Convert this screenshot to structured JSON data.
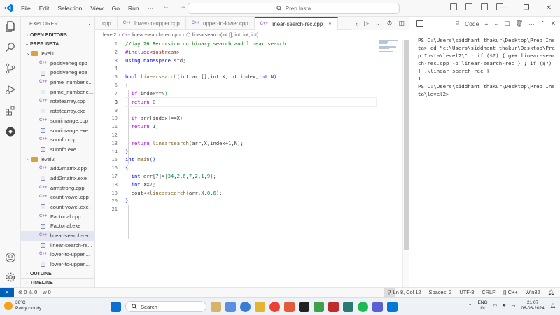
{
  "titlebar": {
    "menu": [
      "File",
      "Edit",
      "Selection",
      "View",
      "Go",
      "Run"
    ],
    "more": "···",
    "search_placeholder": "Prep Insta",
    "nav_back": "←",
    "nav_forward": "→",
    "window_controls": [
      "—",
      "❐",
      "✕"
    ]
  },
  "sidebar": {
    "title": "EXPLORER",
    "more": "···",
    "open_editors": "OPEN EDITORS",
    "project": "PREP INSTA",
    "level1_folder": "level1",
    "level1_files": [
      {
        "name": "positiveneg.cpp",
        "type": "cpp"
      },
      {
        "name": "positiveneg.exe",
        "type": "exe"
      },
      {
        "name": "prime_number.c...",
        "type": "cpp"
      },
      {
        "name": "prime_number.e...",
        "type": "exe"
      },
      {
        "name": "rotatearray.cpp",
        "type": "cpp"
      },
      {
        "name": "rotatearray.exe",
        "type": "exe"
      },
      {
        "name": "suminrange.cpp",
        "type": "cpp"
      },
      {
        "name": "suminrange.exe",
        "type": "exe"
      },
      {
        "name": "sunofn.cpp",
        "type": "cpp"
      },
      {
        "name": "sunofn.exe",
        "type": "exe"
      }
    ],
    "level2_folder": "level2",
    "level2_files": [
      {
        "name": "add2matrix.cpp",
        "type": "cpp"
      },
      {
        "name": "add2matrix.exe",
        "type": "exe"
      },
      {
        "name": "armstrong.cpp",
        "type": "cpp"
      },
      {
        "name": "count-vowel.cpp",
        "type": "cpp"
      },
      {
        "name": "count-vowel.exe",
        "type": "exe"
      },
      {
        "name": "Factorial.cpp",
        "type": "cpp"
      },
      {
        "name": "Factorial.exe",
        "type": "exe"
      },
      {
        "name": "linear-search-rec...",
        "type": "cpp",
        "selected": true
      },
      {
        "name": "linear-search-re...",
        "type": "exe"
      },
      {
        "name": "lower-to-upper....",
        "type": "cpp"
      },
      {
        "name": "lower-to-upper....",
        "type": "exe"
      }
    ],
    "outline": "OUTLINE",
    "timeline": "TIMELINE"
  },
  "tabs": [
    {
      "label": ".cpp",
      "icon": "",
      "active": false
    },
    {
      "label": "lower-to-upper.cpp",
      "icon": "C++",
      "active": false
    },
    {
      "label": "upper-to-lower.cpp",
      "icon": "C++",
      "active": false
    },
    {
      "label": "linear-search-rec.cpp",
      "icon": "C++",
      "active": true
    }
  ],
  "tab_close": "×",
  "breadcrumb": {
    "folder": "level2",
    "file_icon": "C++",
    "file": "linear-search-rec.cpp",
    "symbol": "linearsearch(int [], int, int, int)"
  },
  "editor": {
    "current_line": 8,
    "line_numbers": [
      "1",
      "2",
      "3",
      "4",
      "5",
      "6",
      "7",
      "8",
      "9",
      "10",
      "11",
      "12",
      "13",
      "14",
      "15",
      "16",
      "17",
      "18",
      "19",
      "20",
      "21"
    ]
  },
  "terminal": {
    "label": "Code",
    "output": "PS C:\\Users\\siddhant thakur\\Desktop\\Prep Insta> cd \"c:\\Users\\siddhant thakur\\Desktop\\Prep Insta\\level2\\\" ; if ($?) { g++ linear-search-rec.cpp -o linear-search-rec } ; if ($?) { .\\linear-search-rec }\n1\nPS C:\\Users\\siddhant thakur\\Desktop\\Prep Insta\\level2>"
  },
  "statusbar": {
    "remote": "⨯",
    "errors": "⊗ 0 ⚠ 0",
    "ports": "ᴡ 0",
    "position": "Ln 8, Col 12",
    "spaces": "Spaces: 2",
    "encoding": "UTF-8",
    "eol": "CRLF",
    "language": "{} C++",
    "platform": "Win32",
    "bell": "🔔"
  },
  "taskbar": {
    "temperature": "36°C",
    "weather": "Partly cloudy",
    "search": "Search",
    "lang_top": "ENG",
    "lang_bottom": "IN",
    "time": "21:07",
    "date": "08-06-2024"
  },
  "colors": {
    "accent": "#005fb8",
    "comment": "#008000",
    "keyword": "#0000ff",
    "preprocessor": "#af00db",
    "number": "#098658"
  }
}
